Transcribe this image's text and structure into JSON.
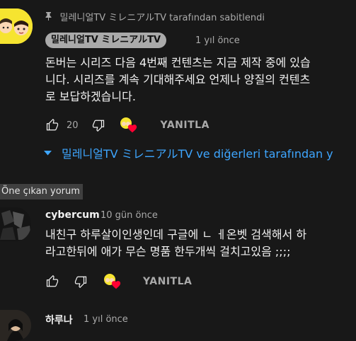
{
  "pinned_comment": {
    "pinned_text": "밀레니얼TV ミレニアルTV tarafından sabitlendi",
    "channel_chip": "밀레니얼TV ミレニアルTV",
    "time": "1 yıl önce",
    "body_line1": "돈버는 시리즈 다음 4번째 컨텐츠는 지금 제작 중에 있습",
    "body_line2": "니다.  시리즈를 계속 기대해주세요 언제나 양질의 컨텐츠",
    "body_line3": "로 보답하겠습니다.",
    "like_count": "20",
    "reply_label": "YANITLA",
    "replies_link": "밀레니얼TV ミレニアルTV ve diğerleri tarafından y"
  },
  "section_badge": "Öne çıkan yorum",
  "second_comment": {
    "author": "cybercum",
    "time": "10 gün önce",
    "body_line1": "내친구 하루살이인생인데 구글에 ㄴ ㅔ온벳 검색해서 하",
    "body_line2": "라고한뒤에 애가 무슨 명품 한두개씩 걸치고있음 ;;;;",
    "reply_label": "YANITLA"
  },
  "third_comment": {
    "author": "하루나",
    "time": "1 yıl önce"
  },
  "colors": {
    "background": "#181818",
    "link": "#3ea6ff",
    "heart": "#ff0033",
    "chip": "#aaaaaa"
  }
}
